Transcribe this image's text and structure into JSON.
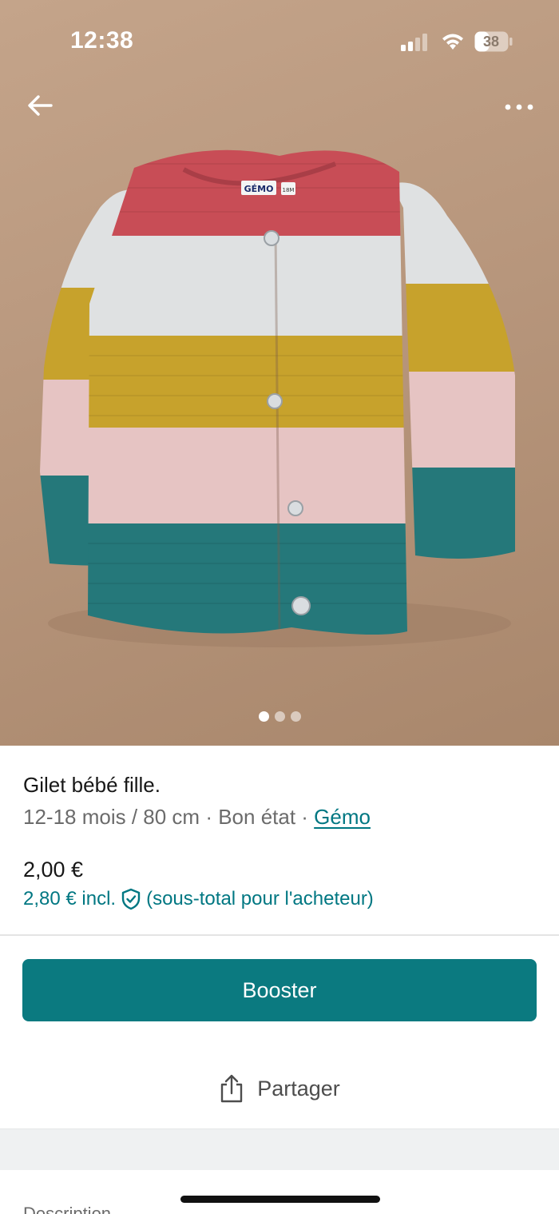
{
  "status_bar": {
    "time": "12:38",
    "battery_level": "38",
    "icons": [
      "signal-icon",
      "wifi-icon",
      "battery-icon"
    ]
  },
  "navigation": {
    "back_icon": "arrow-left-icon",
    "more_icon": "more-horizontal-icon"
  },
  "gallery": {
    "photo_subject": "striped knitted cardigan",
    "photo_label_brand": "GÉMO",
    "photo_label_size": "18M",
    "dot_count": 3,
    "active_dot_index": 0
  },
  "item": {
    "title": "Gilet bébé fille.",
    "size": "12-18 mois / 80 cm",
    "separator": " · ",
    "condition": "Bon état",
    "brand": "Gémo",
    "price": "2,00 €",
    "price_incl": "2,80 € incl.",
    "price_incl_note": "(sous-total pour l'acheteur)",
    "shield_icon": "shield-check-icon"
  },
  "actions": {
    "booster_label": "Booster",
    "share_label": "Partager",
    "share_icon": "share-icon"
  },
  "next_section": {
    "label": "Description"
  },
  "colors": {
    "accent": "#007782",
    "button": "#0b7a80",
    "stripe_red": "#c84d56",
    "stripe_white": "#dfe1e2",
    "stripe_yellow": "#c7a22c",
    "stripe_pink": "#e6c4c3",
    "stripe_teal": "#25787a"
  }
}
